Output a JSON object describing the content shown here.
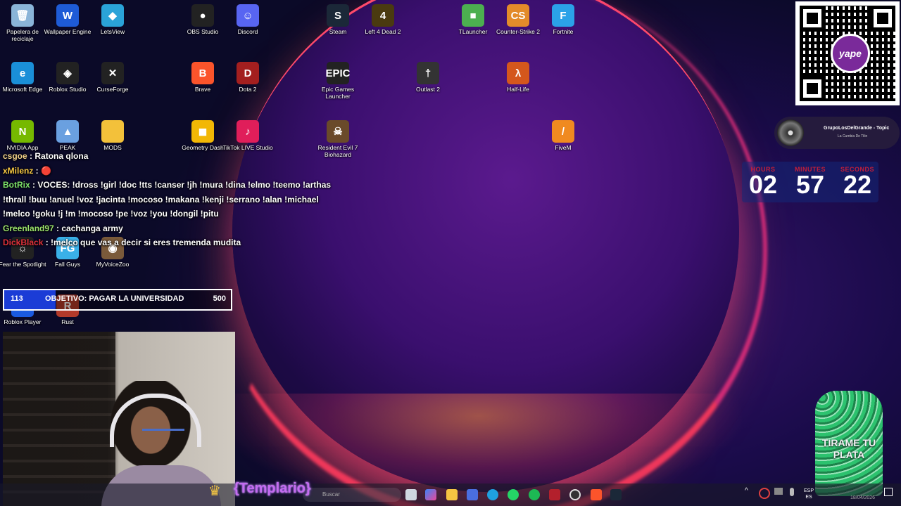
{
  "desktop": {
    "icons": [
      {
        "label": "Papelera de reciclaje",
        "glyph": "🗑"
      },
      {
        "label": "Wallpaper Engine",
        "glyph": "W"
      },
      {
        "label": "LetsView",
        "glyph": "◆"
      },
      {
        "label": "OBS Studio",
        "glyph": "●"
      },
      {
        "label": "Discord",
        "glyph": "☺"
      },
      {
        "label": "Steam",
        "glyph": "S"
      },
      {
        "label": "Left 4 Dead 2",
        "glyph": "4"
      },
      {
        "label": "TLauncher",
        "glyph": "■"
      },
      {
        "label": "Counter-Strike 2",
        "glyph": "CS"
      },
      {
        "label": "Fortnite",
        "glyph": "F"
      },
      {
        "label": "Microsoft Edge",
        "glyph": "e"
      },
      {
        "label": "Roblox Studio",
        "glyph": "◈"
      },
      {
        "label": "CurseForge",
        "glyph": "✕"
      },
      {
        "label": "Brave",
        "glyph": "B"
      },
      {
        "label": "Dota 2",
        "glyph": "D"
      },
      {
        "label": "Epic Games Launcher",
        "glyph": "EPIC"
      },
      {
        "label": "Outlast 2",
        "glyph": "†"
      },
      {
        "label": "Half-Life",
        "glyph": "λ"
      },
      {
        "label": "NVIDIA App",
        "glyph": "N"
      },
      {
        "label": "PEAK",
        "glyph": "▲"
      },
      {
        "label": "MODS",
        "glyph": ""
      },
      {
        "label": "Geometry Dash",
        "glyph": "◼"
      },
      {
        "label": "TikTok LIVE Studio",
        "glyph": "♪"
      },
      {
        "label": "Resident Evil 7 Biohazard",
        "glyph": "☠"
      },
      {
        "label": "FiveM",
        "glyph": "/"
      },
      {
        "label": "Fear the Spotlight",
        "glyph": "☼"
      },
      {
        "label": "Fall Guys",
        "glyph": "FG"
      },
      {
        "label": "MyVoiceZoo",
        "glyph": "◉"
      },
      {
        "label": "Roblox Player",
        "glyph": "◆"
      },
      {
        "label": "Rust",
        "glyph": "R"
      }
    ]
  },
  "qr": {
    "brand": "yape"
  },
  "now_playing": {
    "title": "GrupoLosDelGrande - Topic",
    "subtitle": "La Cumbia De Tilin"
  },
  "countdown": {
    "hours_label": "HOURS",
    "minutes_label": "MINUTES",
    "seconds_label": "SECONDS",
    "hours": "02",
    "minutes": "57",
    "seconds": "22"
  },
  "chat": [
    {
      "user": "csgoe",
      "color": "#f2d28a",
      "text": "Ratona qlona"
    },
    {
      "user": "xMilenz",
      "color": "#f7c843",
      "text": "🔴"
    },
    {
      "user": "BotRix",
      "color": "#7ee36b",
      "text": "VOCES: !dross !girl !doc !tts !canser !jh !mura !dina !elmo !teemo !arthas !thrall !buu !anuel !voz !jacinta !mocoso !makana !kenji !serrano !alan !michael !melco !goku !j !m !mocoso !pe !voz !you !dongil !pitu"
    },
    {
      "user": "Greenland97",
      "color": "#9be36b",
      "text": "cachanga army"
    },
    {
      "user": "DickBlack",
      "color": "#e0313b",
      "text": "!melco que vas a decir si eres tremenda mudita"
    }
  ],
  "goal": {
    "current": "113",
    "title": "OBJETIVO: PAGAR LA UNIVERSIDAD",
    "target": "500",
    "progress": 0.226
  },
  "overlay": {
    "templario": "{Templario}",
    "cactus_text": "TIRAME TU PLATA"
  },
  "taskbar": {
    "search_placeholder": "Buscar",
    "lang_line1": "ESP",
    "lang_line2": "ES",
    "date": "18/04/2026"
  },
  "colors": {
    "goal_fill": "#1b3cd6",
    "countdown_caption": "#c41e3a"
  }
}
